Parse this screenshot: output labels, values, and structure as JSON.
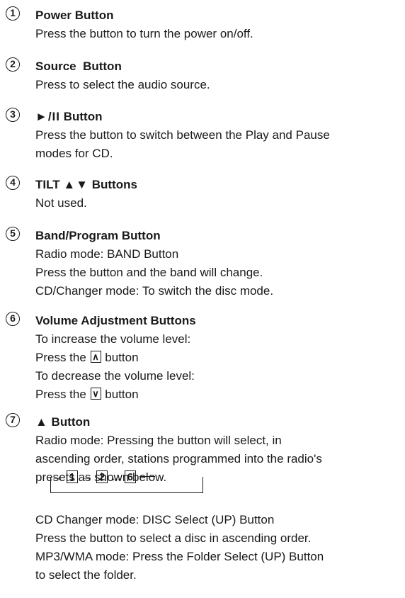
{
  "items": [
    {
      "number": "1",
      "title": "Power Button",
      "lines": [
        "Press the button to turn the power on/off."
      ]
    },
    {
      "number": "2",
      "title": "Source  Button",
      "lines": [
        "Press to select the audio source."
      ]
    },
    {
      "number": "3",
      "title_glyph": "►/II",
      "title_rest": " Button",
      "lines": [
        "Press the button to switch between the Play and Pause",
        "modes for CD."
      ]
    },
    {
      "number": "4",
      "title_text": "TILT ",
      "title_glyph": "▲▼",
      "title_rest": " Buttons",
      "lines": [
        "Not used."
      ]
    },
    {
      "number": "5",
      "title": "Band/Program Button",
      "lines": [
        "Radio mode: BAND Button",
        "Press the button and the band will change.",
        "CD/Changer mode: To switch the disc mode."
      ]
    },
    {
      "number": "6",
      "title": "Volume Adjustment Buttons",
      "lines": [
        "To increase the volume level:",
        "Press the",
        "button",
        "To decrease the volume level:",
        "Press the",
        "button"
      ],
      "up_key": "∧",
      "down_key": "∨"
    },
    {
      "number": "7",
      "title_glyph": "▲",
      "title_rest": " Button",
      "lines": [
        "Radio mode: Pressing the button will select, in",
        "ascending order, stations programmed into the radio's",
        "presets as shown below."
      ],
      "after_lines": [
        "CD Changer mode: DISC Select (UP) Button",
        "Press the button to select a disc in ascending order.",
        "MP3/WMA mode: Press the Folder Select (UP) Button",
        "to select the folder."
      ]
    }
  ],
  "preset_diagram": {
    "arrow": "→",
    "first": "1",
    "second": "2",
    "ellipsis": "...",
    "last": "6"
  }
}
